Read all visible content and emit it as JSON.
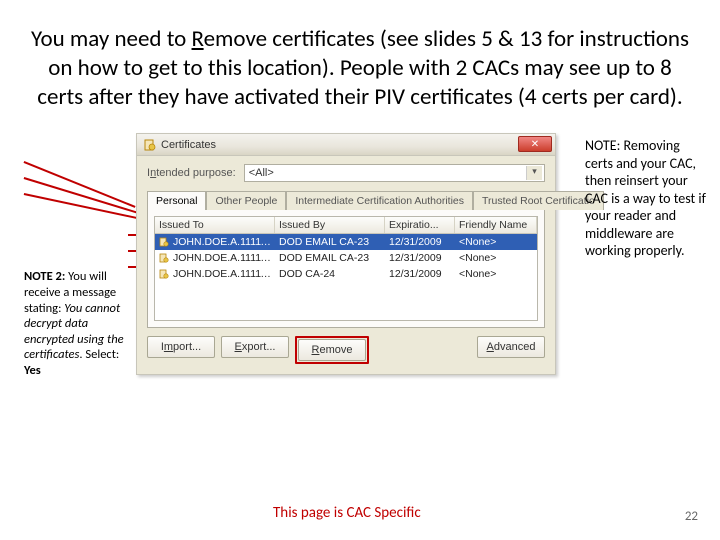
{
  "heading": {
    "pre": "You may need to ",
    "underlined": "R",
    "post": "emove certificates (see slides 5 & 13 for instructions on how to get to this location).  People with 2 CACs may see up to 8 certs after they have activated their PIV certificates (4 certs per card)."
  },
  "note1": "NOTE:  Removing certs and your CAC, then reinsert your CAC is a way to test if your reader and middleware are working properly.",
  "note2": {
    "label": "NOTE 2:",
    "body_a": "  You will receive a message stating:  ",
    "italic": "You cannot decrypt data encrypted using the certificates",
    "body_b": ".  Select:  ",
    "yes": "Yes"
  },
  "specific_text": "This page is CAC Specific",
  "page_number": "22",
  "dialog": {
    "title": "Certificates",
    "purpose_label_pre": "I",
    "purpose_label_u": "n",
    "purpose_label_post": "tended purpose:",
    "purpose_value": "<All>",
    "tabs": {
      "personal": "Personal",
      "other": "Other People",
      "intermediate": "Intermediate Certification Authorities",
      "trusted": "Trusted Root Certificatio"
    },
    "columns": {
      "issued_to": "Issued To",
      "issued_by": "Issued By",
      "expiration": "Expiratio...",
      "friendly": "Friendly Name"
    },
    "rows": [
      {
        "to": "JOHN.DOE.A.11111...",
        "by": "DOD EMAIL CA-23",
        "exp": "12/31/2009",
        "friendly": "<None>",
        "selected": true
      },
      {
        "to": "JOHN.DOE.A.11111...",
        "by": "DOD EMAIL CA-23",
        "exp": "12/31/2009",
        "friendly": "<None>",
        "selected": false
      },
      {
        "to": "JOHN.DOE.A.11111...",
        "by": "DOD CA-24",
        "exp": "12/31/2009",
        "friendly": "<None>",
        "selected": false
      }
    ],
    "buttons": {
      "import_pre": "I",
      "import_u": "m",
      "import_post": "port...",
      "export_pre": "",
      "export_u": "E",
      "export_post": "xport...",
      "remove_pre": "",
      "remove_u": "R",
      "remove_post": "emove",
      "advanced_pre": "",
      "advanced_u": "A",
      "advanced_post": "dvanced"
    }
  }
}
